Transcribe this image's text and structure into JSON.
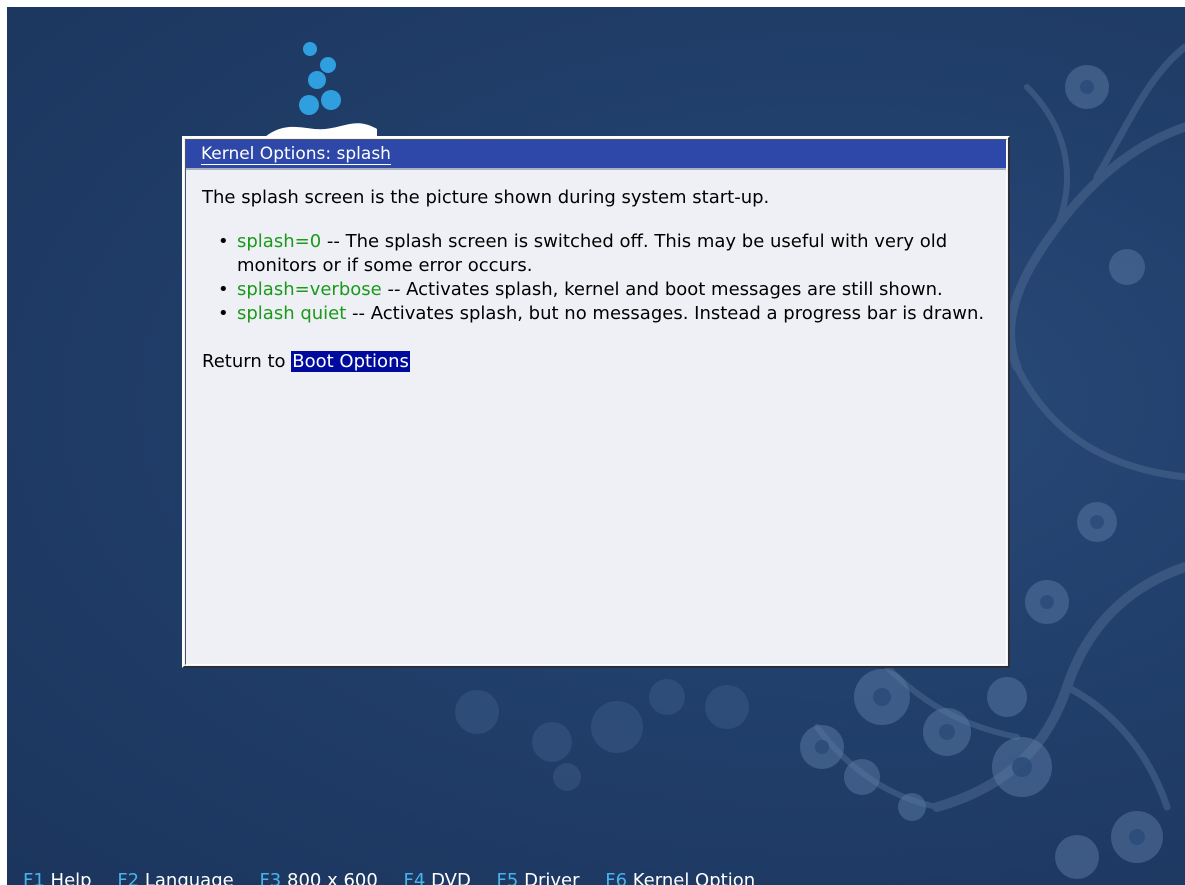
{
  "dialog": {
    "title": "Kernel Options: splash",
    "intro": "The splash screen is the picture shown during system start-up.",
    "options": [
      {
        "keyword": "splash=0",
        "text": " -- The splash screen is switched off. This may be useful with very old monitors or if some error occurs."
      },
      {
        "keyword": "splash=verbose",
        "text": " -- Activates splash, kernel and boot messages are still shown."
      },
      {
        "keyword": "splash quiet",
        "text": " -- Activates splash, but no messages. Instead a progress bar is drawn."
      }
    ],
    "return_prefix": "Return to ",
    "return_link": "Boot Options"
  },
  "function_keys": [
    {
      "key": "F1",
      "label": "Help"
    },
    {
      "key": "F2",
      "label": "Language"
    },
    {
      "key": "F3",
      "label": "800 x 600"
    },
    {
      "key": "F4",
      "label": "DVD"
    },
    {
      "key": "F5",
      "label": "Driver"
    },
    {
      "key": "F6",
      "label": "Kernel Option"
    }
  ],
  "colors": {
    "background": "#213f6b",
    "title_bar": "#2d48a8",
    "keyword": "#1a9a1a",
    "link_highlight": "#000a9c",
    "fkey": "#48b3ec",
    "logo_dots": "#2f9fe0"
  },
  "icons": {
    "logo": "opensuse-bubbles-logo",
    "background": "cherry-blossom-branch-artwork"
  }
}
